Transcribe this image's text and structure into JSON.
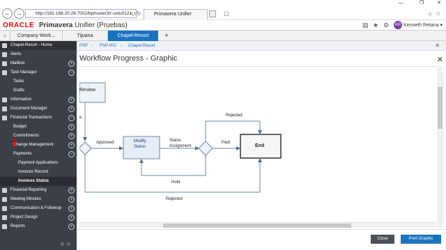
{
  "window": {
    "minimize": "—",
    "restore": "❐",
    "close": "✕"
  },
  "browser": {
    "url": "http://192.168.20.26:7002/bp/route/3/r-uxtu0121_uref",
    "tab_title": "Primavera Unifier",
    "back_icon": "arrow-left",
    "forward_icon": "arrow-right"
  },
  "app": {
    "vendor": "ORACLE",
    "product": "Primavera",
    "product_sub": "Unifier (Pruebas)",
    "user_initials": "KR",
    "user_name": "Kenneth Retana"
  },
  "tabs": [
    {
      "label": "Company Work..."
    },
    {
      "label": "Tijuana"
    },
    {
      "label": "Chapel-Resort"
    }
  ],
  "sidebar": {
    "header": "Chapel-Resort - Home",
    "items": [
      {
        "label": "Alerts"
      },
      {
        "label": "Mailbox"
      },
      {
        "label": "Task Manager"
      },
      {
        "label": "Tasks"
      },
      {
        "label": "Drafts"
      },
      {
        "label": "Information"
      },
      {
        "label": "Document Manager"
      },
      {
        "label": "Financial Transactions"
      },
      {
        "label": "Budget"
      },
      {
        "label": "Commitments"
      },
      {
        "label": "Change Management"
      },
      {
        "label": "Payments"
      },
      {
        "label": "Payment Applications"
      },
      {
        "label": "Invoices Record"
      },
      {
        "label": "Invoices Status"
      },
      {
        "label": "Financial Reporting"
      },
      {
        "label": "Meeting Minutes"
      },
      {
        "label": "Communication & Followup"
      },
      {
        "label": "Project Design"
      },
      {
        "label": "Reports"
      }
    ]
  },
  "breadcrumb": {
    "items": [
      "PSP",
      "PSP-002",
      "Chapel-Resort"
    ]
  },
  "panel": {
    "title": "Workflow Progress - Graphic"
  },
  "diagram": {
    "review": "Review",
    "e": "e",
    "approved": "Approved",
    "modify_status_1": "Modify",
    "modify_status_2": "Status",
    "status_assignment_1": "Status",
    "status_assignment_2": "Assignment",
    "paid": "Paid",
    "end": "End",
    "rejected_top": "Rejected",
    "hold": "Hold",
    "rejected_bottom": "Rejected"
  },
  "footer": {
    "close": "Close",
    "print": "Print Graphic"
  }
}
